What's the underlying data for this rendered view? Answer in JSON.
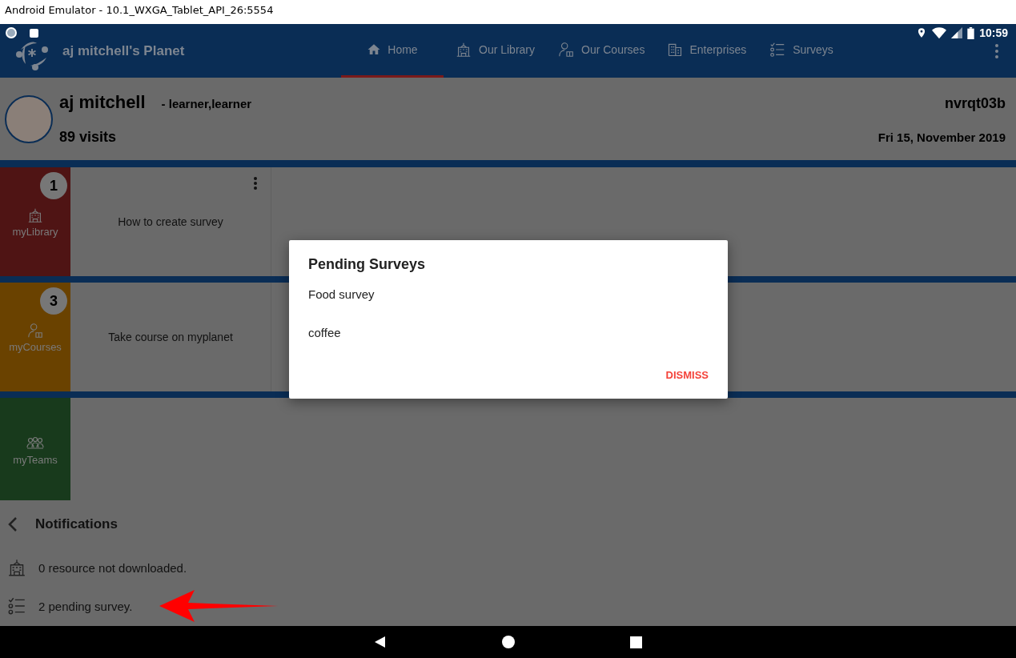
{
  "window": {
    "title": "Android Emulator - 10.1_WXGA_Tablet_API_26:5554"
  },
  "status_bar": {
    "time": "10:59"
  },
  "app_bar": {
    "title": "aj mitchell's Planet"
  },
  "tabs": [
    {
      "label": "Home",
      "kind": "home",
      "selected": true
    },
    {
      "label": "Our Library",
      "kind": "library",
      "selected": false
    },
    {
      "label": "Our Courses",
      "kind": "courses",
      "selected": false
    },
    {
      "label": "Enterprises",
      "kind": "enterprises",
      "selected": false
    },
    {
      "label": "Surveys",
      "kind": "surveys",
      "selected": false
    }
  ],
  "profile": {
    "name": "aj mitchell",
    "role": "- learner,learner",
    "visits": "89 visits",
    "code": "nvrqt03b",
    "date": "Fri 15, November 2019"
  },
  "cards": [
    {
      "label": "myLibrary",
      "kind": "library",
      "color": "#4f1414",
      "badge": "1",
      "items": [
        "How to create survey"
      ]
    },
    {
      "label": "myCourses",
      "kind": "courses",
      "color": "#6a4200",
      "badge": "3",
      "items": [
        "Take course on myplanet"
      ]
    },
    {
      "label": "myTeams",
      "kind": "teams",
      "color": "#183a1c"
    }
  ],
  "notifications": {
    "title": "Notifications",
    "items": [
      {
        "kind": "library",
        "text": "0 resource not downloaded."
      },
      {
        "kind": "surveys",
        "text": "2 pending survey."
      }
    ]
  },
  "dialog": {
    "title": "Pending Surveys",
    "items": [
      "Food survey",
      "coffee"
    ],
    "button": "DISMISS"
  }
}
